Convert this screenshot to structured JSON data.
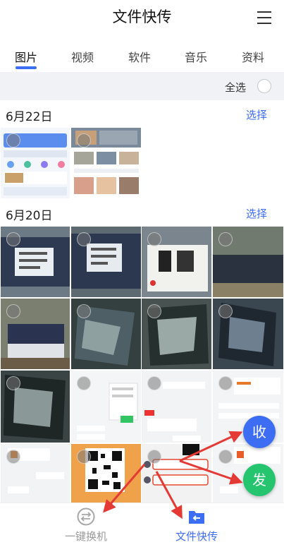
{
  "header": {
    "title": "文件快传"
  },
  "tabs": [
    {
      "label": "图片",
      "active": true
    },
    {
      "label": "视频",
      "active": false
    },
    {
      "label": "软件",
      "active": false
    },
    {
      "label": "音乐",
      "active": false
    },
    {
      "label": "资料",
      "active": false
    }
  ],
  "select_all": {
    "label": "全选"
  },
  "sections": [
    {
      "date": "6月22日",
      "action": "选择"
    },
    {
      "date": "6月20日",
      "action": "选择"
    }
  ],
  "fab": {
    "receive": "收",
    "send": "发"
  },
  "bottom_nav": {
    "left_label": "一键换机",
    "right_label": "文件快传"
  },
  "colors": {
    "accent_blue": "#3d6df2",
    "send_green": "#25c46e",
    "annotation_red": "#e53935"
  },
  "icons": {
    "menu": "hamburger-menu-icon",
    "switch_phone": "swap-arrows-icon",
    "file_transfer": "folder-arrow-icon"
  }
}
